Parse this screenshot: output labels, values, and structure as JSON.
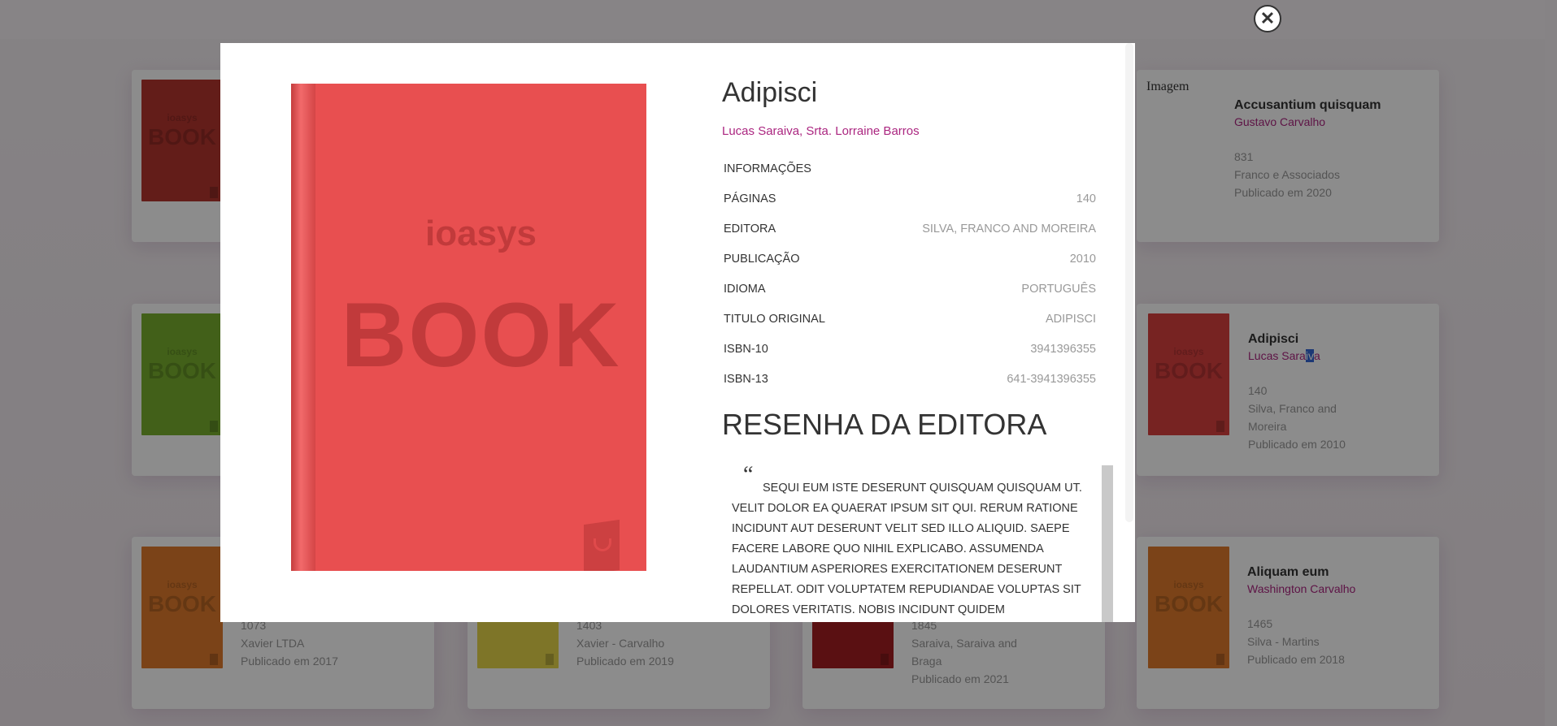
{
  "overlay_close": {
    "glyph": "✕"
  },
  "cards": [
    {
      "title": "",
      "author": "",
      "pages": "",
      "publisher": "",
      "published": "",
      "cover_color": "#b5352f",
      "cover_brand": "ioasys",
      "cover_word": "BOOK",
      "image_alt": ""
    },
    {
      "title": "Accusantium quisquam",
      "author": "Gustavo Carvalho",
      "pages": "831",
      "publisher": "Franco e Associados",
      "published": "Publicado em 2020",
      "image_alt": "Imagem"
    },
    {
      "title": "",
      "author": "",
      "pages": "",
      "publisher": "",
      "published": "",
      "cover_color": "#79b02f",
      "cover_brand": "ioasys",
      "cover_word": "BOOK"
    },
    {
      "title": "Adipisci",
      "author_before": "Lucas Sara",
      "author_sel": "iv",
      "author_after": "a",
      "pages": "140",
      "publisher_line1": "Silva, Franco and",
      "publisher_line2": "Moreira",
      "published": "Publicado em 2010",
      "cover_color": "#d9403f",
      "cover_brand": "ioasys",
      "cover_word": "BOOK"
    },
    {
      "title": "",
      "author": "",
      "pages": "1073",
      "publisher": "Xavier LTDA",
      "published": "Publicado em 2017",
      "cover_color": "#e07a2c",
      "cover_brand": "ioasys",
      "cover_word": "BOOK"
    },
    {
      "title": "",
      "author": "",
      "pages": "1403",
      "publisher": "Xavier - Carvalho",
      "published": "Publicado em 2019",
      "cover_color": "#e6d64a"
    },
    {
      "title": "",
      "author": "",
      "pages": "1845",
      "publisher_line1": "Saraiva, Saraiva and",
      "publisher_line2": "Braga",
      "published": "Publicado em 2021",
      "cover_color": "#a51e22"
    },
    {
      "title": "Aliquam eum",
      "author": "Washington Carvalho",
      "pages": "1465",
      "publisher": "Silva - Martins",
      "published": "Publicado em 2018",
      "cover_color": "#e07a2c",
      "cover_brand": "ioasys",
      "cover_word": "BOOK"
    }
  ],
  "modal": {
    "cover": {
      "brand": "ioasys",
      "word": "BOOK",
      "color": "#e84f50"
    },
    "title": "Adipisci",
    "authors": "Lucas Saraiva, Srta. Lorraine Barros",
    "info_heading": "INFORMAÇÕES",
    "info": [
      {
        "key": "PÁGINAS",
        "value": "140"
      },
      {
        "key": "EDITORA",
        "value": "Silva, Franco and Moreira"
      },
      {
        "key": "PUBLICAÇÃO",
        "value": "2010"
      },
      {
        "key": "IDIOMA",
        "value": "Português"
      },
      {
        "key": "TITULO ORIGINAL",
        "value": "Adipisci"
      },
      {
        "key": "ISBN-10",
        "value": "3941396355"
      },
      {
        "key": "ISBN-13",
        "value": "641-3941396355"
      }
    ],
    "review_heading": "RESENHA DA EDITORA",
    "quote_mark": "“",
    "review": "Sequi eum iste deserunt quisquam quisquam ut. Velit dolor ea quaerat ipsum sit qui. Rerum ratione incidunt aut deserunt velit sed illo aliquid. Saepe facere labore quo nihil explicabo. Assumenda laudantium asperiores exercitationem deserunt repellat. Odit voluptatem repudiandae voluptas sit dolores veritatis. Nobis incidunt quidem praesentium"
  }
}
